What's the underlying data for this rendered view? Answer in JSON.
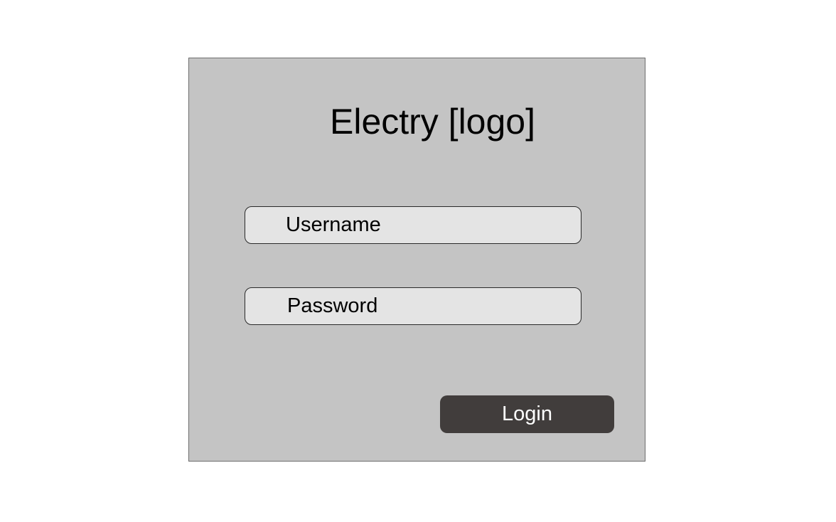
{
  "login": {
    "logo_text": "Electry [logo]",
    "username": {
      "placeholder": "Username",
      "value": ""
    },
    "password": {
      "placeholder": "Password",
      "value": ""
    },
    "login_label": "Login"
  },
  "colors": {
    "panel_background": "#c4c4c4",
    "field_background": "#e4e4e4",
    "button_background": "#413d3c",
    "button_text": "#ffffff"
  }
}
